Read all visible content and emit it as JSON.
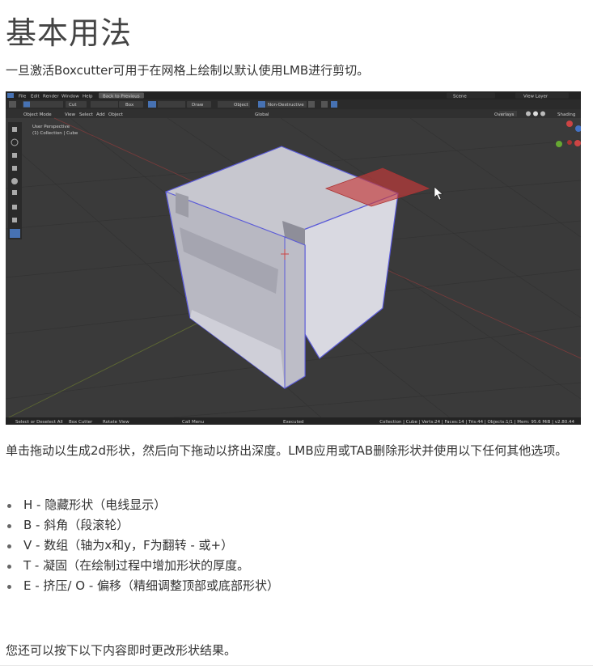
{
  "title": "基本用法",
  "intro": "一旦激活Boxcutter可用于在网格上绘制以默认使用LMB进行剪切。",
  "screenshot": {
    "menu": [
      "File",
      "Edit",
      "Render",
      "Window",
      "Help"
    ],
    "back_button": "Back to Previous",
    "scene_label": "Scene",
    "view_layer_label": "View Layer",
    "tool_mode": "Cut",
    "shape": "Box",
    "draw_mode": "Draw",
    "origin": "Object",
    "behavior": "Non-Destructive",
    "header_menu": [
      "Object Mode",
      "View",
      "Select",
      "Add",
      "Object"
    ],
    "orientation": "Global",
    "overlays_label": "Overlays",
    "shading_label": "Shading",
    "viewport_info": [
      "User Perspective",
      "(1) Collection | Cube"
    ],
    "status_left": [
      "Select or Deselect All",
      "Box Cutter",
      "Rotate View"
    ],
    "status_mid": [
      "Call Menu",
      "Executed"
    ],
    "status_right": "Collection | Cube | Verts:24 | Faces:14 | Tris:44 | Objects:1/1 | Mem: 95.6 MiB | v2.80.44"
  },
  "para": "单击拖动以生成2d形状，然后向下拖动以挤出深度。LMB应用或TAB删除形状并使用以下任何其他选项。",
  "options": [
    "H - 隐藏形状（电线显示）",
    "B - 斜角（段滚轮）",
    "V - 数组（轴为x和y，F为翻转 - 或+）",
    "T - 凝固（在绘制过程中增加形状的厚度。",
    "E - 挤压/ O - 偏移（精细调整顶部或底部形状）"
  ],
  "outro": "您还可以按下以下内容即时更改形状结果。",
  "colors": {
    "accent_blue": "#4772b3",
    "cut_red": "#b23a3a",
    "grid_bg": "#3a3a3a"
  }
}
